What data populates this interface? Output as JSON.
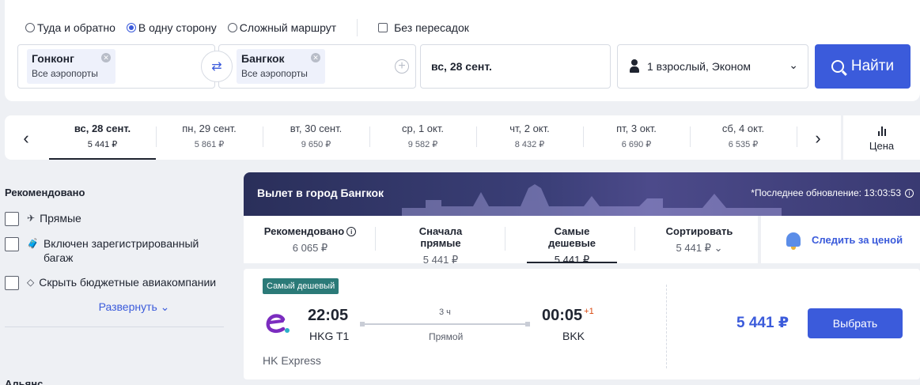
{
  "search": {
    "trip_types": [
      {
        "label": "Туда и обратно",
        "selected": false
      },
      {
        "label": "В одну сторону",
        "selected": true
      },
      {
        "label": "Сложный маршрут",
        "selected": false
      }
    ],
    "nonstop_label": "Без пересадок",
    "from": {
      "city": "Гонконг",
      "sub": "Все аэропорты"
    },
    "to": {
      "city": "Бангкок",
      "sub": "Все аэропорты"
    },
    "date": "вс, 28 сент.",
    "passengers": "1 взрослый, Эконом",
    "search_button": "Найти"
  },
  "date_strip": {
    "days": [
      {
        "label": "вс, 28 сент.",
        "price": "5 441 ₽",
        "active": true
      },
      {
        "label": "пн, 29 сент.",
        "price": "5 861 ₽",
        "active": false
      },
      {
        "label": "вт, 30 сент.",
        "price": "9 650 ₽",
        "active": false
      },
      {
        "label": "ср, 1 окт.",
        "price": "9 582 ₽",
        "active": false
      },
      {
        "label": "чт, 2 окт.",
        "price": "8 432 ₽",
        "active": false
      },
      {
        "label": "пт, 3 окт.",
        "price": "6 690 ₽",
        "active": false
      },
      {
        "label": "сб, 4 окт.",
        "price": "6 535 ₽",
        "active": false
      }
    ],
    "price_chart_label": "Цена"
  },
  "filters": {
    "title": "Рекомендовано",
    "items": [
      {
        "label": "Прямые"
      },
      {
        "label": "Включен зарегистрированный багаж"
      },
      {
        "label": "Скрыть бюджетные авиакомпании"
      }
    ],
    "expand_label": "Развернуть",
    "next_section": "Альянс"
  },
  "results": {
    "banner_title": "Вылет в город Бангкок",
    "last_update": "*Последнее обновление: 13:03:53",
    "sort_tabs": [
      {
        "label": "Рекомендовано",
        "price": "6 065 ₽",
        "active": false
      },
      {
        "label": "Сначала прямые",
        "price": "5 441 ₽",
        "active": false
      },
      {
        "label": "Самые дешевые",
        "price": "5 441 ₽",
        "active": true
      },
      {
        "label": "Сортировать",
        "price": "5 441 ₽",
        "active": false
      }
    ],
    "track_price_label": "Следить за ценой",
    "tickets": [
      {
        "badge": "Самый дешевый",
        "dep_time": "22:05",
        "dep_code": "HKG T1",
        "arr_time": "00:05",
        "arr_day_offset": "+1",
        "arr_code": "BKK",
        "duration": "3 ч",
        "stops": "Прямой",
        "airline": "HK Express",
        "price": "5 441 ₽",
        "select_label": "Выбрать"
      }
    ]
  },
  "colors": {
    "accent": "#3b5bdb",
    "badge": "#2b7a78",
    "airline_brand": "#7b2cbf"
  }
}
